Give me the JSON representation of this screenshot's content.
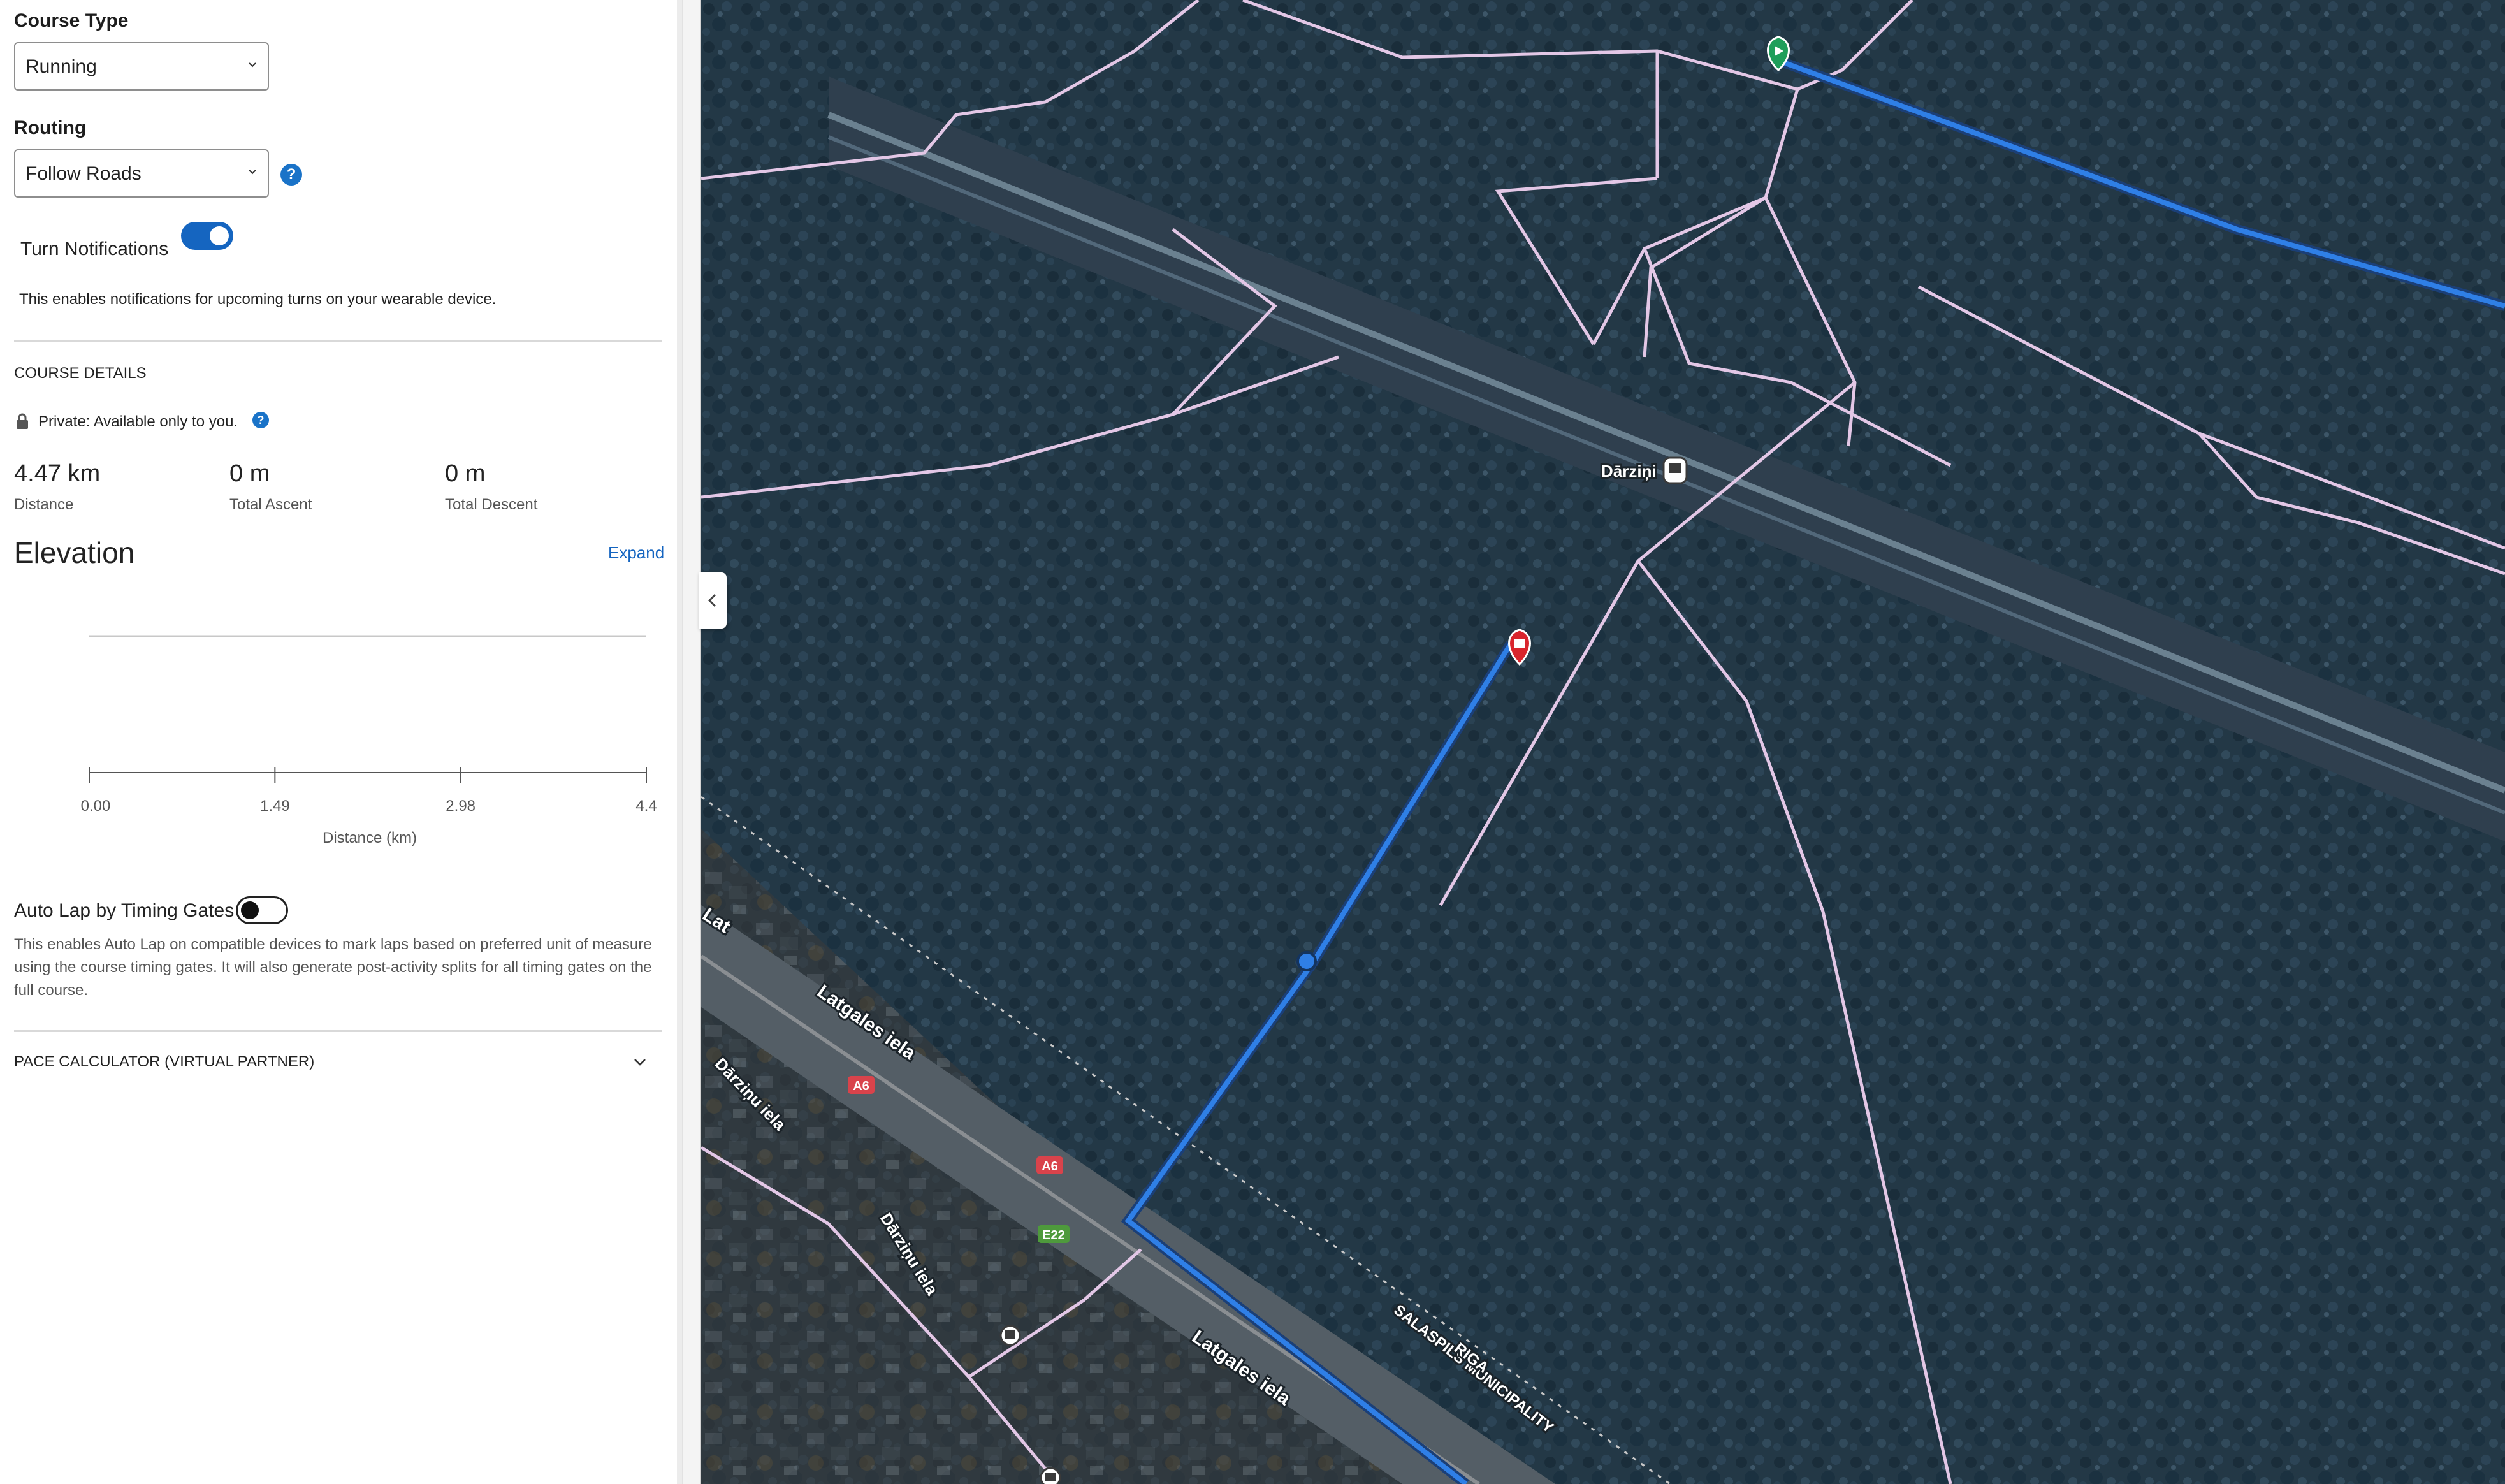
{
  "course_type": {
    "label": "Course Type",
    "value": "Running"
  },
  "routing": {
    "label": "Routing",
    "value": "Follow Roads",
    "help": "?"
  },
  "turn_notifications": {
    "label": "Turn Notifications",
    "enabled": true,
    "description": "This enables notifications for upcoming turns on your wearable device."
  },
  "course_details": {
    "heading": "COURSE DETAILS",
    "privacy": "Private: Available only to you.",
    "help": "?",
    "stats": [
      {
        "value": "4.47 km",
        "label": "Distance"
      },
      {
        "value": "0 m",
        "label": "Total Ascent"
      },
      {
        "value": "0 m",
        "label": "Total Descent"
      }
    ]
  },
  "elevation": {
    "title": "Elevation",
    "expand_label": "Expand",
    "chart_data": {
      "type": "line",
      "title": "Elevation",
      "xlabel": "Distance (km)",
      "ylabel": "",
      "x_ticks": [
        "0.00",
        "1.49",
        "2.98",
        "4.4"
      ],
      "xlim": [
        0,
        4.47
      ],
      "series": [
        {
          "x": [
            0,
            4.47
          ],
          "y": [
            0,
            0
          ]
        }
      ],
      "grid": false
    }
  },
  "auto_lap": {
    "label": "Auto Lap by Timing Gates",
    "enabled": false,
    "description": "This enables Auto Lap on compatible devices to mark laps based on preferred unit of measure using the course timing gates. It will also generate post-activity splits for all timing gates on the full course."
  },
  "pace_calculator": {
    "label": "PACE CALCULATOR (VIRTUAL PARTNER)"
  },
  "map": {
    "labels": {
      "station": "Dārziņi",
      "street1": "Latgales iela",
      "street2": "Latgales iela",
      "street3": "Dārziņu iela",
      "street4": "Dārziņu iela",
      "street5": "Lat",
      "boundary1": "SALASPILS MUNICIPALITY",
      "boundary2": "RIGA",
      "shield1": "A6",
      "shield2": "A6",
      "shield3": "E22"
    },
    "colors": {
      "route": "#2f7fe6",
      "paths": "#e8c9e8",
      "start_marker": "#1e9e5a",
      "end_marker": "#d9252d"
    }
  }
}
